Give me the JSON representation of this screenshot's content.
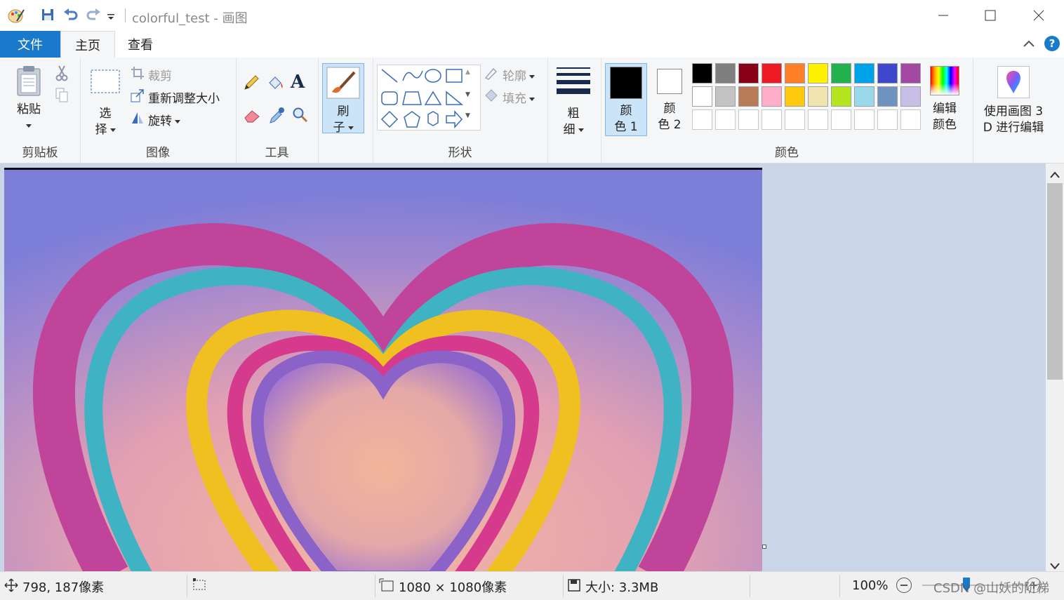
{
  "window": {
    "title": "colorful_test - 画图"
  },
  "tabs": [
    {
      "label": "文件"
    },
    {
      "label": "主页"
    },
    {
      "label": "查看"
    }
  ],
  "ribbon": {
    "clipboard": {
      "paste": "粘贴",
      "group": "剪贴板"
    },
    "image": {
      "select_line1": "选",
      "select_line2": "择",
      "crop": "裁剪",
      "resize": "重新调整大小",
      "rotate": "旋转",
      "group": "图像"
    },
    "tools": {
      "group": "工具"
    },
    "brushes": {
      "line1": "刷",
      "line2": "子"
    },
    "shapes": {
      "outline": "轮廓",
      "fill": "填充",
      "group": "形状"
    },
    "size": {
      "line1": "粗",
      "line2": "细"
    },
    "colors": {
      "color1_line1": "颜",
      "color1_line2": "色 1",
      "color2_line1": "颜",
      "color2_line2": "色 2",
      "edit_line1": "编辑",
      "edit_line2": "颜色",
      "group": "颜色",
      "color1": "#000000",
      "color2": "#ffffff",
      "palette_row1": [
        "#000000",
        "#7f7f7f",
        "#880015",
        "#ed1c24",
        "#ff7f27",
        "#fff200",
        "#22b14c",
        "#00a2e8",
        "#3f48cc",
        "#a349a4"
      ],
      "palette_row2": [
        "#ffffff",
        "#c3c3c3",
        "#b97a57",
        "#ffaec9",
        "#ffc90e",
        "#efe4b0",
        "#b5e61d",
        "#99d9ea",
        "#7092be",
        "#c8bfe7"
      ]
    },
    "paint3d": {
      "line1": "使用画图 3",
      "line2": "D 进行编辑"
    }
  },
  "status": {
    "cursor": "798, 187像素",
    "dimensions": "1080 × 1080像素",
    "size": "大小: 3.3MB",
    "zoom": "100%",
    "watermark": "CSDN @山妖的阶梯"
  }
}
